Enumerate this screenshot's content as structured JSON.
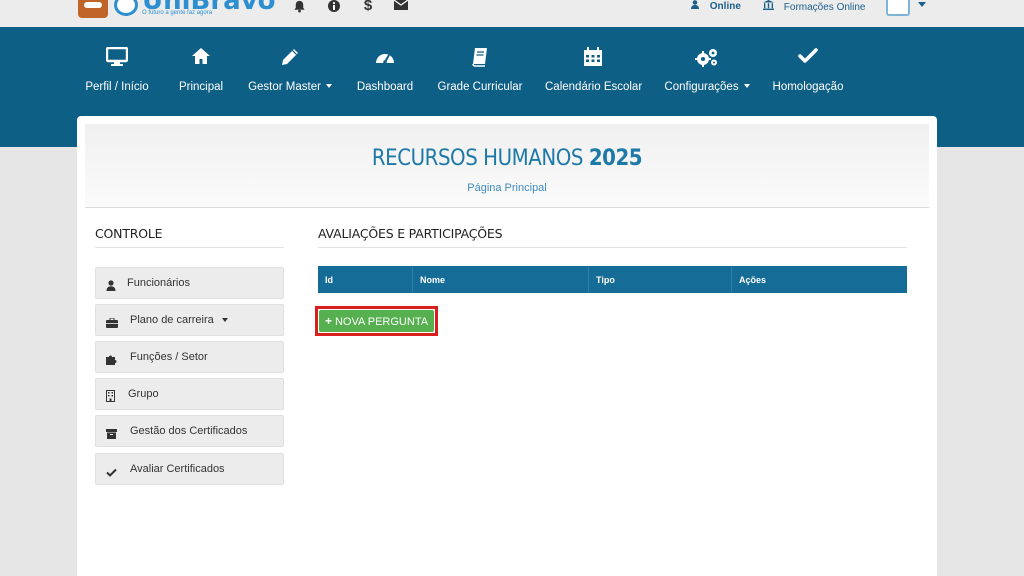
{
  "brand": {
    "name": "UniBravo",
    "tagline": "O futuro a gente faz agora"
  },
  "topbar": {
    "icons": [
      "bell-icon",
      "info-icon",
      "dollar-icon",
      "envelope-icon"
    ],
    "online_label": "Online",
    "formacoes_label": "Formações Online"
  },
  "nav": {
    "items": [
      {
        "label": "Perfil / Início",
        "icon": "monitor-icon"
      },
      {
        "label": "Principal",
        "icon": "home-icon"
      },
      {
        "label": "Gestor Master",
        "icon": "pencil-icon",
        "dropdown": true
      },
      {
        "label": "Dashboard",
        "icon": "dashboard-icon"
      },
      {
        "label": "Grade Curricular",
        "icon": "book-icon"
      },
      {
        "label": "Calendário Escolar",
        "icon": "calendar-icon"
      },
      {
        "label": "Configurações",
        "icon": "gears-icon",
        "dropdown": true
      },
      {
        "label": "Homologação",
        "icon": "check-icon"
      }
    ]
  },
  "header": {
    "title_main": "RECURSOS HUMANOS",
    "title_year": "2025",
    "subtitle": "Página Principal"
  },
  "sidebar": {
    "title": "CONTROLE",
    "items": [
      {
        "label": "Funcionários",
        "icon": "user-icon"
      },
      {
        "label": "Plano de carreira",
        "icon": "briefcase-icon",
        "dropdown": true
      },
      {
        "label": "Funções / Setor",
        "icon": "puzzle-icon"
      },
      {
        "label": "Grupo",
        "icon": "building-icon"
      },
      {
        "label": "Gestão dos Certificados",
        "icon": "archive-icon"
      },
      {
        "label": "Avaliar Certificados",
        "icon": "check-icon"
      }
    ]
  },
  "main": {
    "title": "AVALIAÇÕES E PARTICIPAÇÕES",
    "table": {
      "columns": [
        "Id",
        "Nome",
        "Tipo",
        "Ações"
      ]
    },
    "new_button": "NOVA PERGUNTA"
  },
  "colors": {
    "nav_bg": "#0e5f86",
    "table_header_bg": "#156c96",
    "button_green": "#56b04f",
    "highlight_red": "#d71f1f"
  }
}
